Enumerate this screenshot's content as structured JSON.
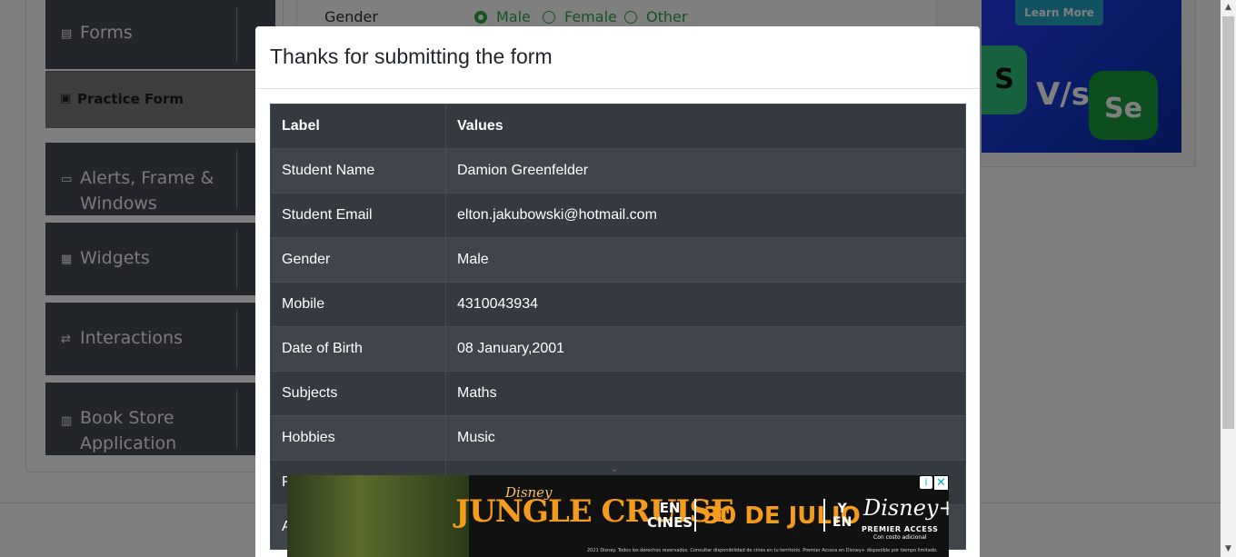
{
  "sidebar": {
    "groups": [
      {
        "label": "Forms"
      },
      {
        "label": "Alerts, Frame & Windows"
      },
      {
        "label": "Widgets"
      },
      {
        "label": "Interactions"
      },
      {
        "label": "Book Store Application"
      }
    ],
    "active_item": "Practice Form"
  },
  "form": {
    "gender_label": "Gender",
    "options": [
      "Male",
      "Female",
      "Other"
    ],
    "selected": "Male"
  },
  "right_ad": {
    "learn_more": "Learn More",
    "vs_text": "V/s",
    "se_text": "Se",
    "s_text": "S"
  },
  "modal": {
    "title": "Thanks for submitting the form",
    "table": {
      "headers": [
        "Label",
        "Values"
      ],
      "rows": [
        [
          "Student Name",
          "Damion Greenfelder"
        ],
        [
          "Student Email",
          "elton.jakubowski@hotmail.com"
        ],
        [
          "Gender",
          "Male"
        ],
        [
          "Mobile",
          "4310043934"
        ],
        [
          "Date of Birth",
          "08 January,2001"
        ],
        [
          "Subjects",
          "Maths"
        ],
        [
          "Hobbies",
          "Music"
        ],
        [
          "P",
          ""
        ],
        [
          "A",
          ""
        ]
      ]
    }
  },
  "banner_ad": {
    "brand_small": "Disney",
    "title": "JUNGLE CRUISE",
    "en": "EN",
    "cines": "CINES",
    "date": "30 DE JULIO",
    "y": "Y",
    "en2": "EN",
    "disney_plus": "Disney+",
    "premier": "PREMIER ACCESS",
    "coste": "Con costo adicional",
    "legal": "2021 Disney. Todos los derechos reservados. Consultar disponibilidad de cines en tu territorio. Premier Access en Disney+ disponible por tiempo limitado.",
    "info": "i",
    "close": "✕"
  },
  "colors": {
    "accent_green": "#28a745",
    "table_dark": "#343a40",
    "table_stripe": "#3f454b",
    "sidebar_bg": "#454c55"
  }
}
